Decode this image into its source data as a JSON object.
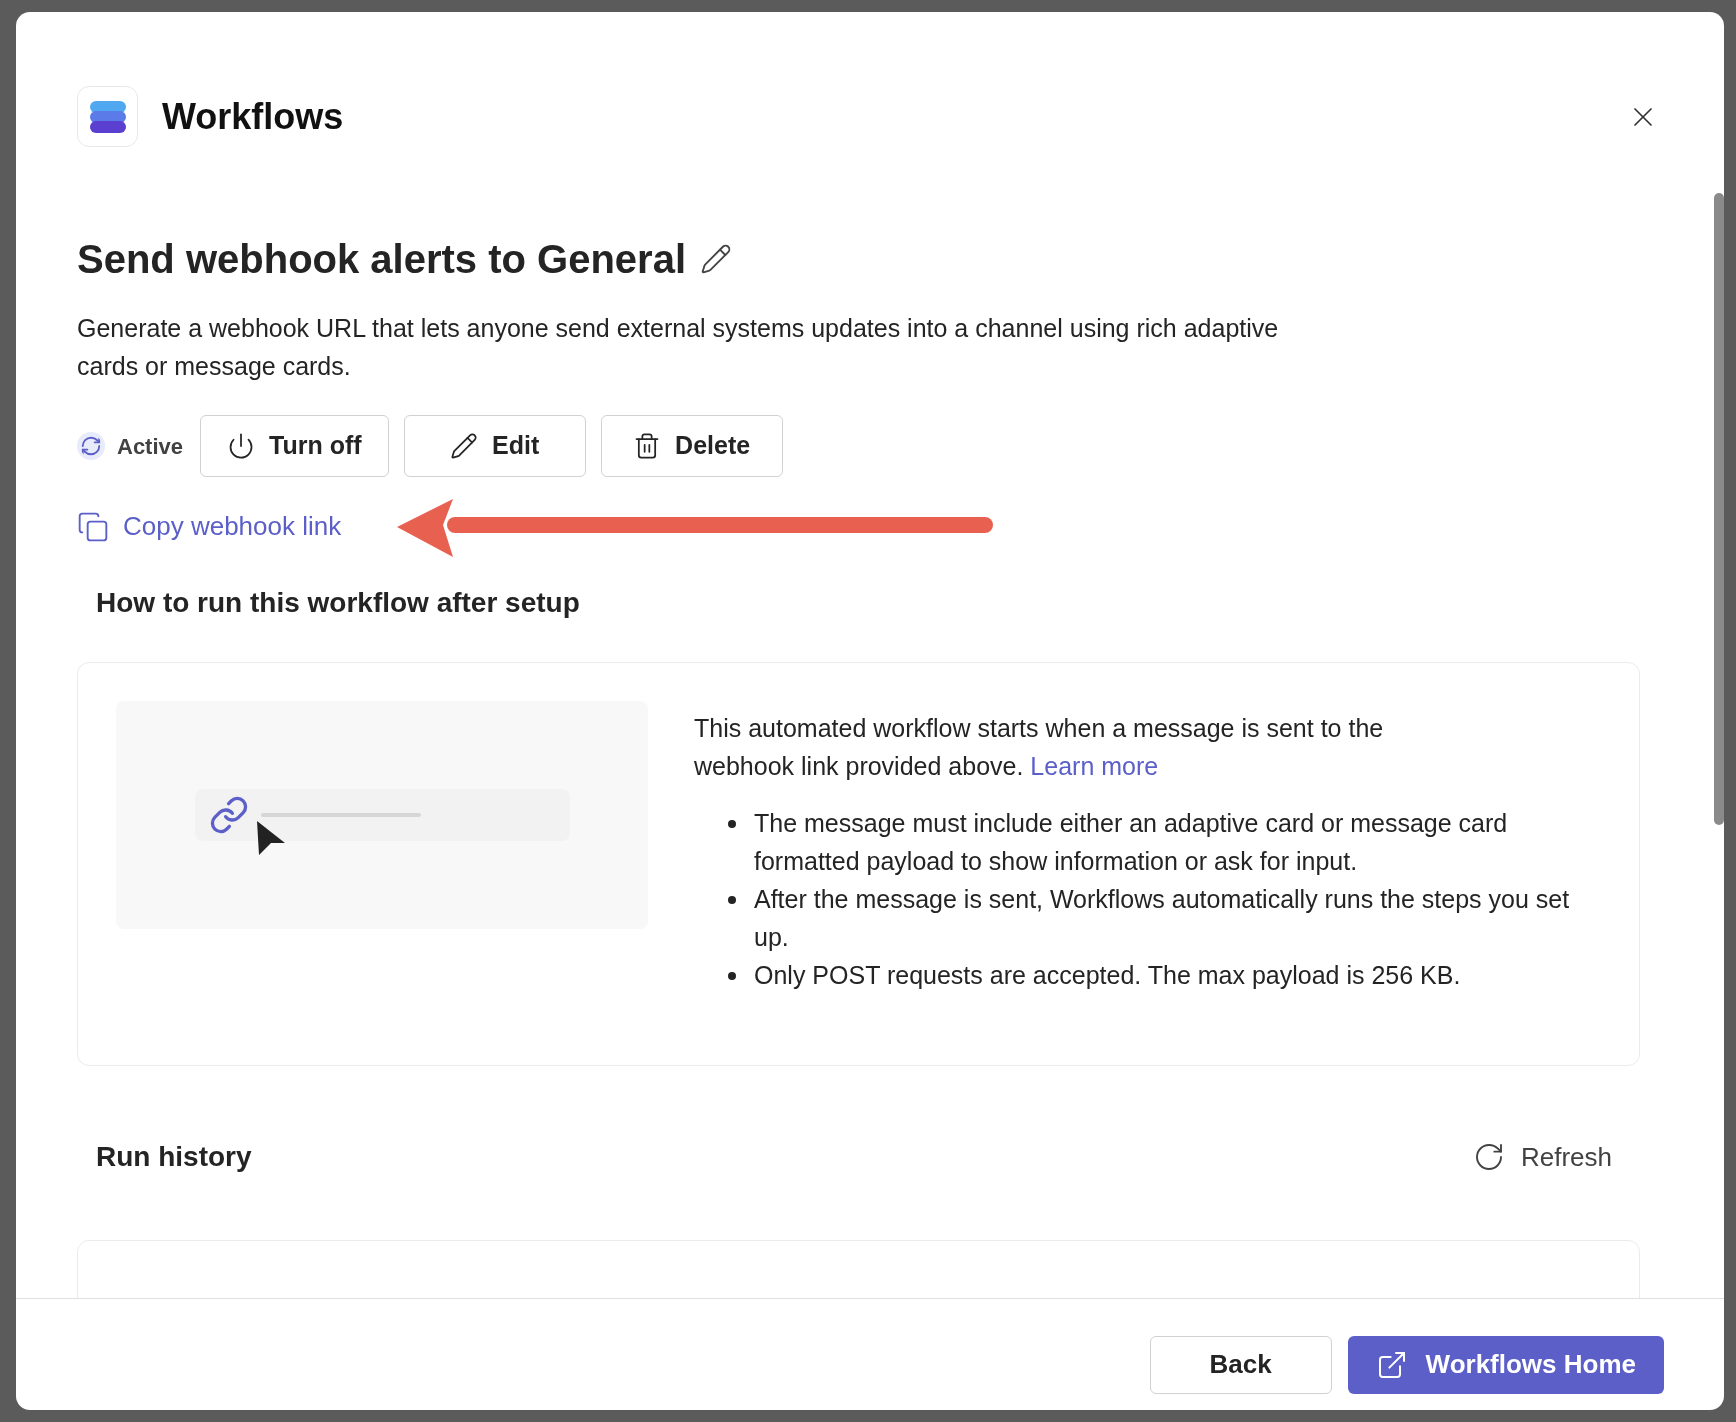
{
  "app": {
    "title": "Workflows"
  },
  "workflow": {
    "name": "Send webhook alerts to General",
    "description": "Generate a webhook URL that lets anyone send external systems updates into a channel using rich adaptive cards or message cards.",
    "status": "Active",
    "actions": [
      {
        "label": "Turn off",
        "kind": "power"
      },
      {
        "label": "Edit",
        "kind": "edit"
      },
      {
        "label": "Delete",
        "kind": "delete"
      }
    ],
    "copy_link": "Copy webhook link"
  },
  "how_to_run": {
    "title": "How to run this workflow after setup",
    "intro": "This automated workflow starts when a message is sent to the webhook link provided above.",
    "learn_more": "Learn more",
    "bullets": [
      "The message must include either an adaptive card or message card formatted payload to show information or ask for input.",
      "After the message is sent, Workflows automatically runs the steps you set up.",
      "Only POST requests are accepted. The max payload is 256 KB."
    ]
  },
  "run_history": {
    "title": "Run history",
    "refresh": "Refresh"
  },
  "footer": {
    "buttons": [
      {
        "label": "Back",
        "kind": "secondary"
      },
      {
        "label": "Workflows Home",
        "kind": "primary"
      }
    ]
  }
}
